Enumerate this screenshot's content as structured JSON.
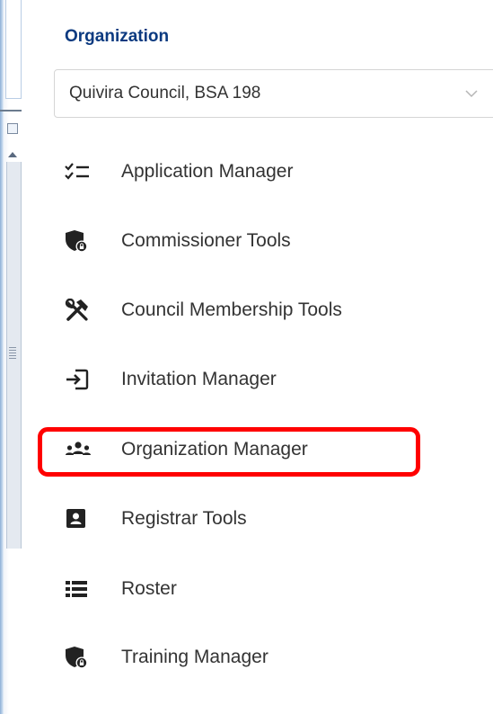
{
  "organization": {
    "label": "Organization",
    "selected": "Quivira Council, BSA 198"
  },
  "menu": [
    {
      "label": "Application Manager",
      "icon": "checklist-icon"
    },
    {
      "label": "Commissioner Tools",
      "icon": "shield-lock-icon"
    },
    {
      "label": "Council Membership Tools",
      "icon": "tools-icon"
    },
    {
      "label": "Invitation Manager",
      "icon": "sign-in-icon"
    },
    {
      "label": "Organization Manager",
      "icon": "people-group-icon"
    },
    {
      "label": "Registrar Tools",
      "icon": "id-card-icon"
    },
    {
      "label": "Roster",
      "icon": "list-icon"
    },
    {
      "label": "Training Manager",
      "icon": "shield-lock-icon"
    }
  ],
  "colors": {
    "heading": "#0b3a80",
    "highlight_border": "#ff0000",
    "icon": "#222222"
  }
}
